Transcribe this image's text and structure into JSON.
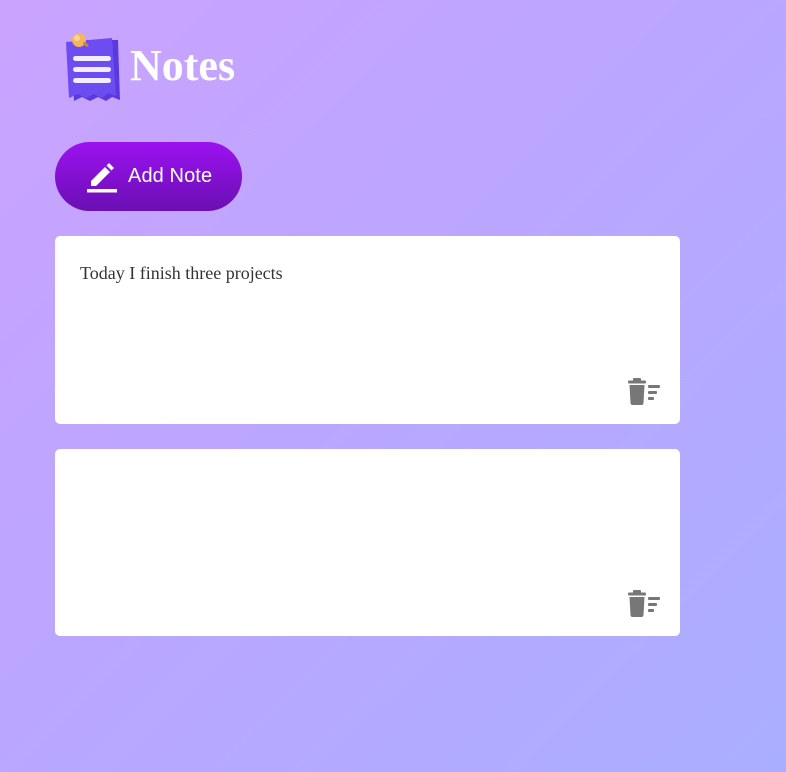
{
  "app": {
    "title": "Notes",
    "logo_icon": "notepad-pin-icon"
  },
  "toolbar": {
    "add_label": "Add Note",
    "add_icon": "pencil-icon"
  },
  "notes": [
    {
      "text": "Today I finish three projects",
      "delete_icon": "trash-icon"
    },
    {
      "text": "",
      "delete_icon": "trash-icon"
    }
  ],
  "colors": {
    "button_gradient_top": "#9c12f0",
    "button_gradient_bottom": "#6a0fb3",
    "background_start": "#caa3ff",
    "background_end": "#aaaeff",
    "card": "#ffffff",
    "icon_gray": "#777777"
  }
}
